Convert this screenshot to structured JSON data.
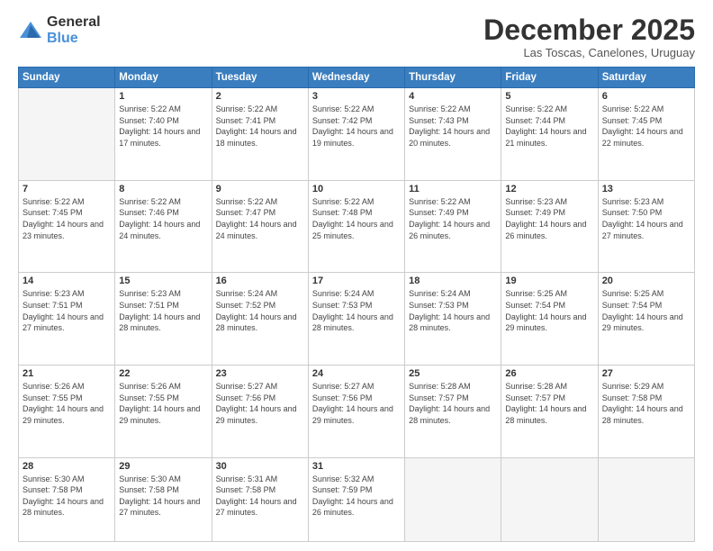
{
  "logo": {
    "general": "General",
    "blue": "Blue"
  },
  "title": "December 2025",
  "location": "Las Toscas, Canelones, Uruguay",
  "weekdays": [
    "Sunday",
    "Monday",
    "Tuesday",
    "Wednesday",
    "Thursday",
    "Friday",
    "Saturday"
  ],
  "weeks": [
    [
      {
        "day": null,
        "sunrise": null,
        "sunset": null,
        "daylight": null
      },
      {
        "day": "1",
        "sunrise": "5:22 AM",
        "sunset": "7:40 PM",
        "daylight": "14 hours and 17 minutes."
      },
      {
        "day": "2",
        "sunrise": "5:22 AM",
        "sunset": "7:41 PM",
        "daylight": "14 hours and 18 minutes."
      },
      {
        "day": "3",
        "sunrise": "5:22 AM",
        "sunset": "7:42 PM",
        "daylight": "14 hours and 19 minutes."
      },
      {
        "day": "4",
        "sunrise": "5:22 AM",
        "sunset": "7:43 PM",
        "daylight": "14 hours and 20 minutes."
      },
      {
        "day": "5",
        "sunrise": "5:22 AM",
        "sunset": "7:44 PM",
        "daylight": "14 hours and 21 minutes."
      },
      {
        "day": "6",
        "sunrise": "5:22 AM",
        "sunset": "7:45 PM",
        "daylight": "14 hours and 22 minutes."
      }
    ],
    [
      {
        "day": "7",
        "sunrise": "5:22 AM",
        "sunset": "7:45 PM",
        "daylight": "14 hours and 23 minutes."
      },
      {
        "day": "8",
        "sunrise": "5:22 AM",
        "sunset": "7:46 PM",
        "daylight": "14 hours and 24 minutes."
      },
      {
        "day": "9",
        "sunrise": "5:22 AM",
        "sunset": "7:47 PM",
        "daylight": "14 hours and 24 minutes."
      },
      {
        "day": "10",
        "sunrise": "5:22 AM",
        "sunset": "7:48 PM",
        "daylight": "14 hours and 25 minutes."
      },
      {
        "day": "11",
        "sunrise": "5:22 AM",
        "sunset": "7:49 PM",
        "daylight": "14 hours and 26 minutes."
      },
      {
        "day": "12",
        "sunrise": "5:23 AM",
        "sunset": "7:49 PM",
        "daylight": "14 hours and 26 minutes."
      },
      {
        "day": "13",
        "sunrise": "5:23 AM",
        "sunset": "7:50 PM",
        "daylight": "14 hours and 27 minutes."
      }
    ],
    [
      {
        "day": "14",
        "sunrise": "5:23 AM",
        "sunset": "7:51 PM",
        "daylight": "14 hours and 27 minutes."
      },
      {
        "day": "15",
        "sunrise": "5:23 AM",
        "sunset": "7:51 PM",
        "daylight": "14 hours and 28 minutes."
      },
      {
        "day": "16",
        "sunrise": "5:24 AM",
        "sunset": "7:52 PM",
        "daylight": "14 hours and 28 minutes."
      },
      {
        "day": "17",
        "sunrise": "5:24 AM",
        "sunset": "7:53 PM",
        "daylight": "14 hours and 28 minutes."
      },
      {
        "day": "18",
        "sunrise": "5:24 AM",
        "sunset": "7:53 PM",
        "daylight": "14 hours and 28 minutes."
      },
      {
        "day": "19",
        "sunrise": "5:25 AM",
        "sunset": "7:54 PM",
        "daylight": "14 hours and 29 minutes."
      },
      {
        "day": "20",
        "sunrise": "5:25 AM",
        "sunset": "7:54 PM",
        "daylight": "14 hours and 29 minutes."
      }
    ],
    [
      {
        "day": "21",
        "sunrise": "5:26 AM",
        "sunset": "7:55 PM",
        "daylight": "14 hours and 29 minutes."
      },
      {
        "day": "22",
        "sunrise": "5:26 AM",
        "sunset": "7:55 PM",
        "daylight": "14 hours and 29 minutes."
      },
      {
        "day": "23",
        "sunrise": "5:27 AM",
        "sunset": "7:56 PM",
        "daylight": "14 hours and 29 minutes."
      },
      {
        "day": "24",
        "sunrise": "5:27 AM",
        "sunset": "7:56 PM",
        "daylight": "14 hours and 29 minutes."
      },
      {
        "day": "25",
        "sunrise": "5:28 AM",
        "sunset": "7:57 PM",
        "daylight": "14 hours and 28 minutes."
      },
      {
        "day": "26",
        "sunrise": "5:28 AM",
        "sunset": "7:57 PM",
        "daylight": "14 hours and 28 minutes."
      },
      {
        "day": "27",
        "sunrise": "5:29 AM",
        "sunset": "7:58 PM",
        "daylight": "14 hours and 28 minutes."
      }
    ],
    [
      {
        "day": "28",
        "sunrise": "5:30 AM",
        "sunset": "7:58 PM",
        "daylight": "14 hours and 28 minutes."
      },
      {
        "day": "29",
        "sunrise": "5:30 AM",
        "sunset": "7:58 PM",
        "daylight": "14 hours and 27 minutes."
      },
      {
        "day": "30",
        "sunrise": "5:31 AM",
        "sunset": "7:58 PM",
        "daylight": "14 hours and 27 minutes."
      },
      {
        "day": "31",
        "sunrise": "5:32 AM",
        "sunset": "7:59 PM",
        "daylight": "14 hours and 26 minutes."
      },
      {
        "day": null,
        "sunrise": null,
        "sunset": null,
        "daylight": null
      },
      {
        "day": null,
        "sunrise": null,
        "sunset": null,
        "daylight": null
      },
      {
        "day": null,
        "sunrise": null,
        "sunset": null,
        "daylight": null
      }
    ]
  ]
}
